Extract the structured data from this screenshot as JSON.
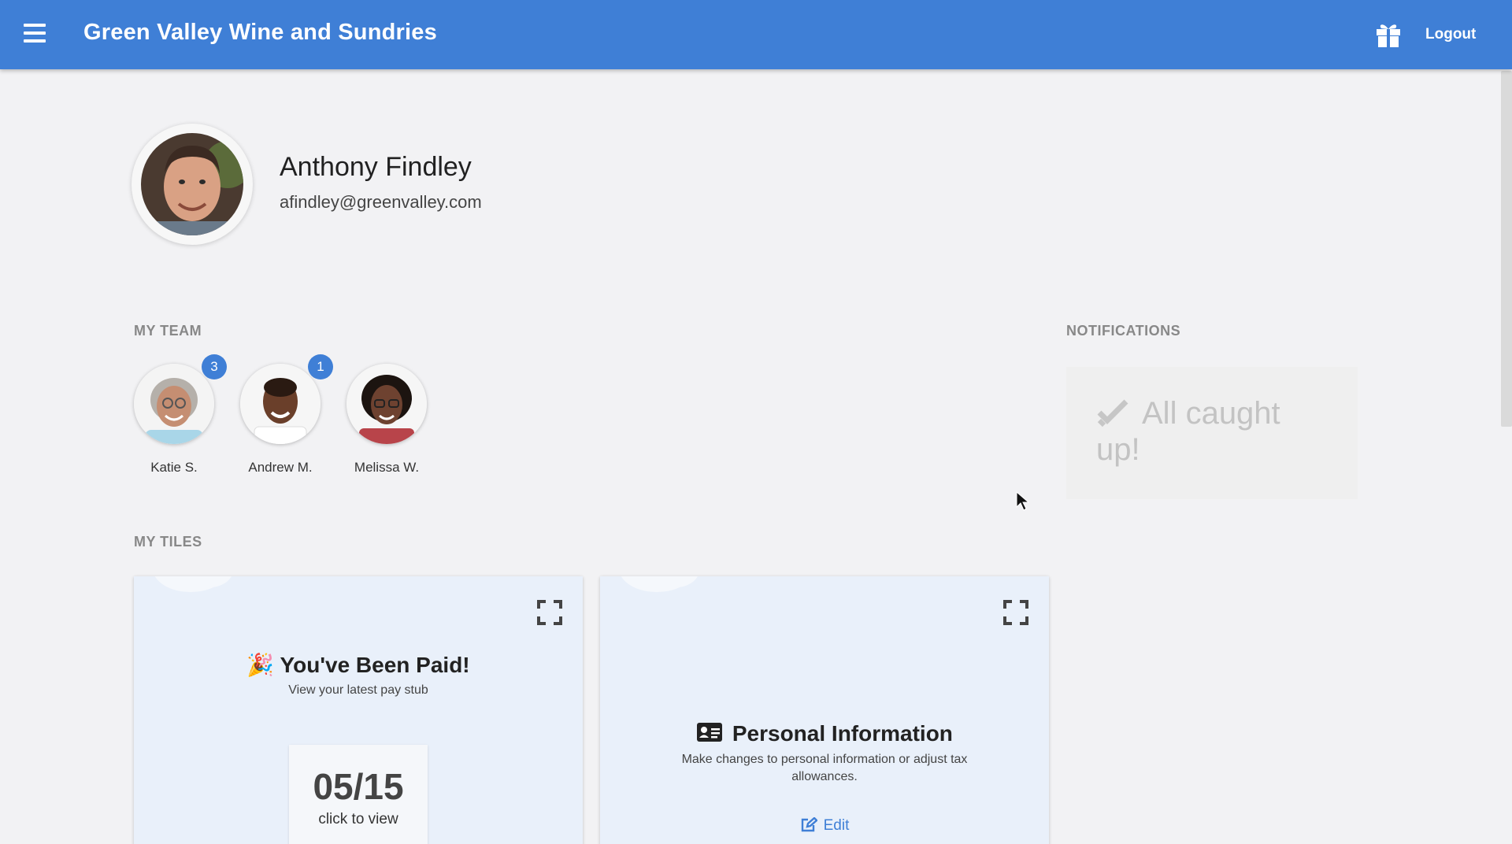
{
  "header": {
    "title": "Green Valley Wine and Sundries",
    "logout_label": "Logout",
    "menu_icon": "hamburger-menu-icon",
    "gift_icon": "gift-icon",
    "color": "#3f7fd6"
  },
  "profile": {
    "name": "Anthony Findley",
    "email": "afindley@greenvalley.com"
  },
  "team": {
    "label": "MY TEAM",
    "members": [
      {
        "name": "Katie S.",
        "badge": "3"
      },
      {
        "name": "Andrew M.",
        "badge": "1"
      },
      {
        "name": "Melissa W.",
        "badge": ""
      }
    ]
  },
  "notifications": {
    "label": "NOTIFICATIONS",
    "message": "All caught up!",
    "icon": "double-check-icon"
  },
  "tiles": {
    "label": "MY TILES",
    "items": [
      {
        "emoji": "🎉",
        "title": "You've Been Paid!",
        "subtitle": "View your latest pay stub",
        "date": "05/15",
        "cta": "click to view"
      },
      {
        "icon": "id-card-icon",
        "title": "Personal Information",
        "subtitle": "Make changes to personal information or adjust tax allowances.",
        "action": "Edit"
      }
    ]
  }
}
